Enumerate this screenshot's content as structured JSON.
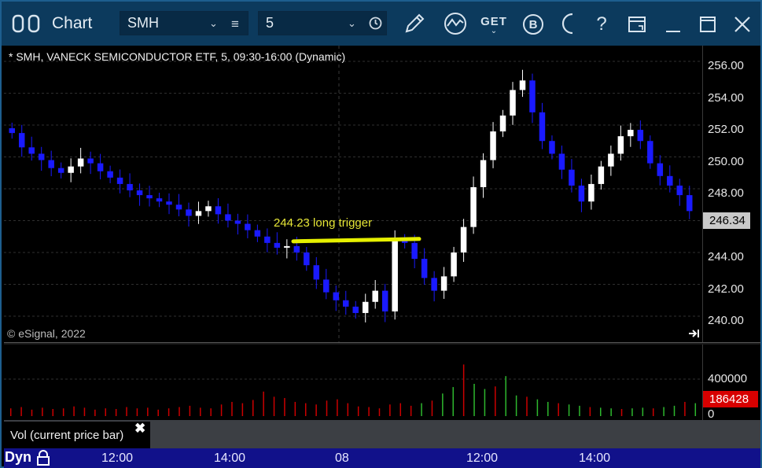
{
  "toolbar": {
    "title": "Chart",
    "symbol": "SMH",
    "interval": "5",
    "icons": [
      "layout-toggle-icon",
      "menu-lines-icon",
      "clock-icon",
      "draw-pencil-icon",
      "study-wave-icon",
      "get-icon",
      "buy-b-icon",
      "moon-theme-icon",
      "help-icon",
      "window-icon",
      "minimize-icon",
      "maximize-icon",
      "close-icon"
    ],
    "get_label": "GET",
    "buy_label": "B",
    "help_label": "?"
  },
  "chart": {
    "info": "* SMH, VANECK SEMICONDUCTOR ETF, 5, 09:30-16:00 (Dynamic)",
    "copyright": "© eSignal, 2022",
    "annotation": "244.23 long trigger",
    "last_price": "246.34",
    "price_ticks": [
      "256.00",
      "254.00",
      "252.00",
      "250.00",
      "248.00",
      "244.00",
      "242.00",
      "240.00"
    ],
    "volume_value": "186428",
    "volume_ticks": [
      "400000",
      "0"
    ],
    "volume_label": "Vol (current price bar)",
    "dyn_label": "Dyn",
    "time_ticks": [
      "12:00",
      "14:00",
      "08",
      "12:00",
      "14:00"
    ],
    "colors": {
      "up": "#ffffff",
      "down": "#1a1aff",
      "trigger": "#e6f000",
      "vol_up": "#2eb82e",
      "vol_down": "#cc0000"
    }
  },
  "chart_data": {
    "type": "candlestick",
    "ylim": [
      239.5,
      257.0
    ],
    "close_series": [
      251.5,
      250.6,
      250.2,
      249.8,
      249.3,
      249.0,
      249.4,
      249.9,
      249.6,
      249.1,
      248.7,
      248.3,
      247.9,
      247.6,
      247.4,
      247.2,
      247.0,
      246.7,
      246.3,
      246.6,
      246.9,
      246.4,
      246.0,
      245.8,
      245.4,
      245.0,
      244.6,
      244.3,
      244.4,
      244.0,
      243.2,
      242.3,
      241.5,
      241.0,
      240.6,
      240.2,
      240.9,
      241.6,
      240.3,
      244.8,
      244.6,
      243.6,
      242.4,
      241.6,
      242.5,
      244.0,
      245.6,
      248.1,
      249.8,
      251.6,
      252.6,
      254.2,
      254.8,
      252.8,
      251.0,
      250.2,
      249.2,
      248.2,
      247.2,
      248.3,
      249.4,
      250.2,
      251.3,
      251.7,
      251.0,
      249.6,
      248.8,
      248.2,
      247.6,
      246.6
    ],
    "vol_levels": [
      0.12,
      0.14,
      0.1,
      0.13,
      0.11,
      0.12,
      0.15,
      0.13,
      0.1,
      0.12,
      0.11,
      0.14,
      0.12,
      0.13,
      0.1,
      0.12,
      0.14,
      0.16,
      0.13,
      0.12,
      0.18,
      0.22,
      0.2,
      0.25,
      0.38,
      0.3,
      0.28,
      0.22,
      0.2,
      0.18,
      0.24,
      0.26,
      0.2,
      0.15,
      0.14,
      0.12,
      0.18,
      0.2,
      0.16,
      0.2,
      0.24,
      0.35,
      0.45,
      0.8,
      0.5,
      0.42,
      0.46,
      0.62,
      0.32,
      0.3,
      0.26,
      0.22,
      0.2,
      0.18,
      0.16,
      0.14,
      0.13,
      0.12,
      0.11,
      0.12,
      0.13,
      0.12,
      0.14,
      0.16,
      0.22,
      0.2
    ]
  }
}
